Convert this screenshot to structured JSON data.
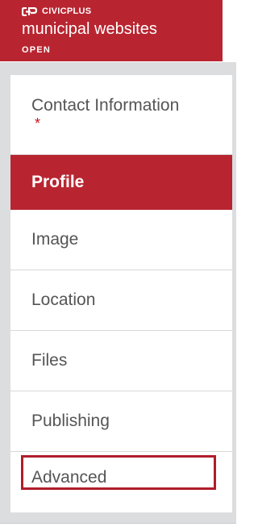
{
  "brand": {
    "company": "CIVICPLUS",
    "product": "municipal websites",
    "edition": "OPEN",
    "logo_icon": "civicplus-logo-icon",
    "color": "#b82530"
  },
  "nav": {
    "items": [
      {
        "label": "Contact Information",
        "required_marker": "*"
      },
      {
        "label": "Profile",
        "active": true
      },
      {
        "label": "Image"
      },
      {
        "label": "Location"
      },
      {
        "label": "Files"
      },
      {
        "label": "Publishing"
      },
      {
        "label": "Advanced",
        "focused": true
      }
    ],
    "active_color": "#b82530",
    "text_color": "#555555",
    "required_color": "#c4121d"
  }
}
